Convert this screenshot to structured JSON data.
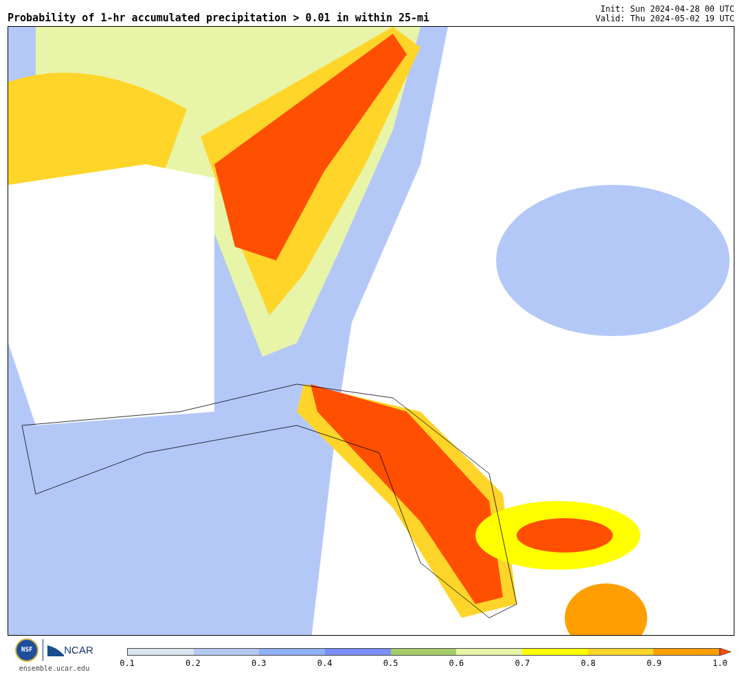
{
  "title": "Probability of 1-hr accumulated precipitation > 0.01 in within 25-mi",
  "init": "Init: Sun 2024-04-28 00 UTC",
  "valid": "Valid: Thu 2024-05-02 19 UTC",
  "logos": {
    "nsf": "NSF",
    "ncar": "NCAR",
    "site": "ensemble.ucar.edu"
  },
  "colorbar": {
    "segments": [
      {
        "color": "#dbe5f0"
      },
      {
        "color": "#b4c8f8"
      },
      {
        "color": "#8fb0fa"
      },
      {
        "color": "#7b8ffa"
      },
      {
        "color": "#a5cc68"
      },
      {
        "color": "#e8f5a8"
      },
      {
        "color": "#ffff00"
      },
      {
        "color": "#ffd52a"
      },
      {
        "color": "#ff9e00"
      }
    ],
    "extend": {
      "color": "#ff4f00"
    },
    "ticks": [
      "0.1",
      "0.2",
      "0.3",
      "0.4",
      "0.5",
      "0.6",
      "0.7",
      "0.8",
      "0.9",
      "1.0"
    ]
  }
}
